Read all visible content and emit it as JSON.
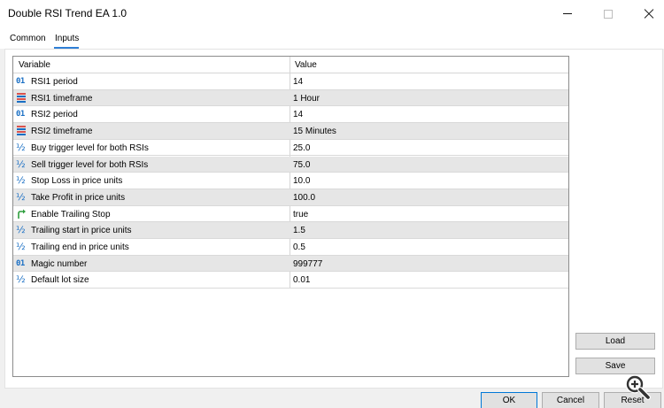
{
  "window": {
    "title": "Double RSI Trend EA 1.0"
  },
  "tabs": [
    {
      "label": "Common"
    },
    {
      "label": "Inputs"
    }
  ],
  "grid": {
    "headers": {
      "variable": "Variable",
      "value": "Value"
    },
    "rows": [
      {
        "icon": "integer-icon",
        "variable": "RSI1 period",
        "value": "14"
      },
      {
        "icon": "enum-icon",
        "variable": "RSI1 timeframe",
        "value": "1 Hour"
      },
      {
        "icon": "integer-icon",
        "variable": "RSI2 period",
        "value": "14"
      },
      {
        "icon": "enum-icon",
        "variable": "RSI2 timeframe",
        "value": "15 Minutes"
      },
      {
        "icon": "double-icon",
        "variable": "Buy trigger level for both RSIs",
        "value": "25.0"
      },
      {
        "icon": "double-icon",
        "variable": "Sell trigger level for both RSIs",
        "value": "75.0"
      },
      {
        "icon": "double-icon",
        "variable": "Stop Loss in price units",
        "value": "10.0"
      },
      {
        "icon": "double-icon",
        "variable": "Take Profit in price units",
        "value": "100.0"
      },
      {
        "icon": "bool-icon",
        "variable": "Enable Trailing Stop",
        "value": "true"
      },
      {
        "icon": "double-icon",
        "variable": "Trailing start in price units",
        "value": "1.5"
      },
      {
        "icon": "double-icon",
        "variable": "Trailing end in price units",
        "value": "0.5"
      },
      {
        "icon": "integer-icon",
        "variable": "Magic number",
        "value": "999777"
      },
      {
        "icon": "double-icon",
        "variable": "Default lot size",
        "value": "0.01"
      }
    ]
  },
  "buttons": {
    "load": "Load",
    "save": "Save",
    "ok": "OK",
    "cancel": "Cancel",
    "reset": "Reset"
  },
  "icons": {
    "integer_glyph": "01",
    "double_glyph": "½",
    "zoom": "zoom-in-icon"
  },
  "colors": {
    "accent": "#2f7fd6",
    "icon_blue": "#1a6fc4",
    "enum_red": "#d9534f",
    "bool_green": "#2e9e3e",
    "row_alt": "#e6e6e6"
  }
}
